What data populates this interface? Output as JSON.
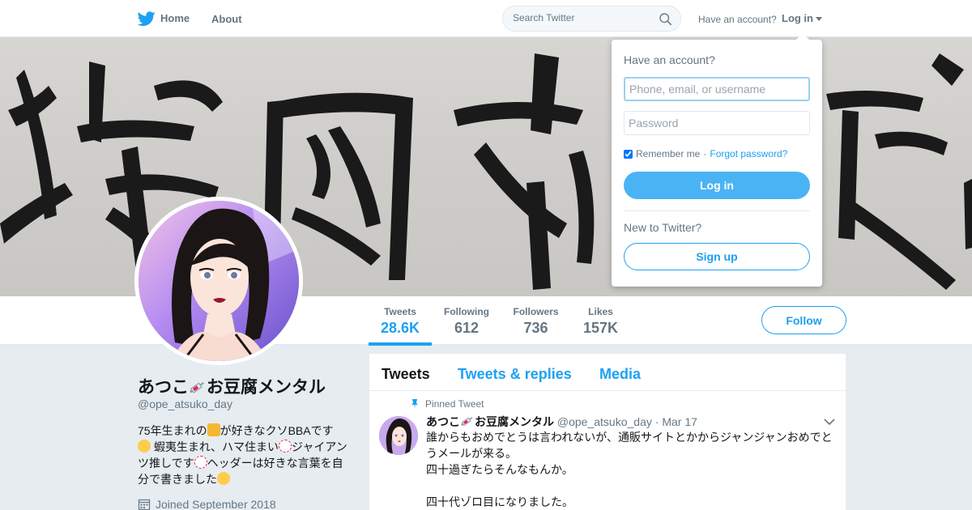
{
  "nav": {
    "home_label": "Home",
    "about_label": "About",
    "search_placeholder": "Search Twitter",
    "have_account_text": "Have an account?",
    "login_label": "Log in"
  },
  "banner": {
    "description_icon": "calligraphy-banner"
  },
  "profile_nav": {
    "stats": [
      {
        "label": "Tweets",
        "value": "28.6K",
        "active": true
      },
      {
        "label": "Following",
        "value": "612"
      },
      {
        "label": "Followers",
        "value": "736"
      },
      {
        "label": "Likes",
        "value": "157K"
      }
    ],
    "follow_label": "Follow"
  },
  "profile": {
    "name": "あつこ💉お豆腐メンタル",
    "name_text": "あつこ",
    "name_suffix": "お豆腐メンタル",
    "handle": "@ope_atsuko_day",
    "bio_line_parts": [
      "75年生まれの",
      "が好きなクソBBAです",
      " 蝦夷生まれ、ハマ住まい",
      "ジャイアンツ推しです",
      "ヘッダーは好きな言葉を自分で書きました"
    ],
    "joined": "Joined September 2018"
  },
  "timeline": {
    "tabs": [
      "Tweets",
      "Tweets & replies",
      "Media"
    ],
    "pinned_label": "Pinned Tweet",
    "tweet": {
      "name_text": "あつこ",
      "name_suffix": "お豆腐メンタル",
      "handle": "@ope_atsuko_day",
      "date": "Mar 17",
      "lines": [
        "誰からもおめでとうは言われないが、通販サイトとかからジャンジャンおめでとうメールが来る。",
        "四十過ぎたらそんなもんか。",
        "",
        "四十代ゾロ目になりました。"
      ]
    }
  },
  "login_dropdown": {
    "title": "Have an account?",
    "username_placeholder": "Phone, email, or username",
    "password_placeholder": "Password",
    "remember_label": "Remember me",
    "separator": "·",
    "forgot_label": "Forgot password?",
    "login_button": "Log in",
    "new_text": "New to Twitter?",
    "signup_button": "Sign up"
  },
  "colors": {
    "accent": "#1da1f2",
    "login_button_bg": "#4ab3f4",
    "page_bg": "#e6ecf0",
    "muted_text": "#657786"
  }
}
